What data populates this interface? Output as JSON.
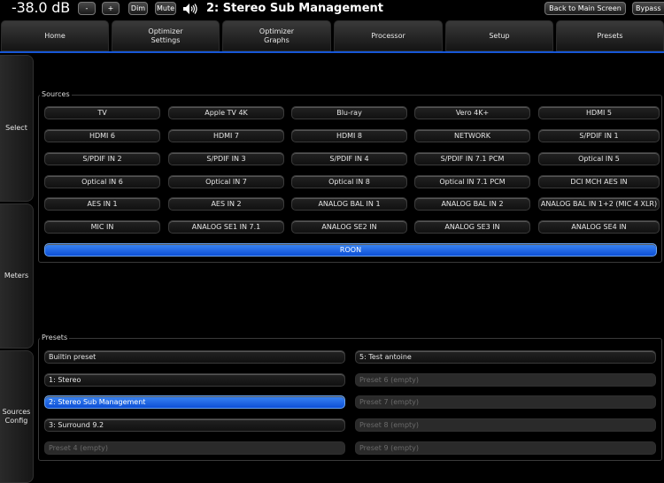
{
  "topbar": {
    "volume": "-38.0 dB",
    "minus_label": "-",
    "plus_label": "+",
    "dim_label": "Dim",
    "mute_label": "Mute",
    "speaker_icon": "speaker-icon",
    "current_preset": "2: Stereo Sub Management",
    "back_label": "Back to Main Screen",
    "bypass_label": "Bypass"
  },
  "tabs": [
    {
      "label": "Home",
      "active": true
    },
    {
      "label": "Optimizer\nSettings",
      "active": false
    },
    {
      "label": "Optimizer\nGraphs",
      "active": false
    },
    {
      "label": "Processor",
      "active": false
    },
    {
      "label": "Setup",
      "active": false
    },
    {
      "label": "Presets",
      "active": false
    }
  ],
  "side": [
    {
      "label": "Select",
      "active": true
    },
    {
      "label": "Meters",
      "active": false
    },
    {
      "label": "Sources\nConfig",
      "active": false
    }
  ],
  "sources": {
    "title": "Sources",
    "buttons": [
      "TV",
      "Apple TV 4K",
      "Blu-ray",
      "Vero 4K+",
      "HDMI 5",
      "HDMI 6",
      "HDMI 7",
      "HDMI 8",
      "NETWORK",
      "S/PDIF IN 1",
      "S/PDIF IN 2",
      "S/PDIF IN 3",
      "S/PDIF IN 4",
      "S/PDIF IN 7.1 PCM",
      "Optical IN 5",
      "Optical IN 6",
      "Optical IN 7",
      "Optical IN 8",
      "Optical IN 7.1 PCM",
      "DCI MCH AES IN",
      "AES IN 1",
      "AES IN 2",
      "ANALOG BAL IN 1",
      "ANALOG BAL IN 2",
      "ANALOG BAL IN 1+2 (MIC 4 XLR)",
      "MIC IN",
      "ANALOG SE1 IN 7.1",
      "ANALOG SE2 IN",
      "ANALOG SE3 IN",
      "ANALOG SE4 IN"
    ],
    "active_button": "ROON"
  },
  "presets": {
    "title": "Presets",
    "left": [
      {
        "label": "Builtin preset",
        "state": "normal"
      },
      {
        "label": "1: Stereo",
        "state": "normal"
      },
      {
        "label": "2: Stereo Sub Management",
        "state": "active"
      },
      {
        "label": "3: Surround 9.2",
        "state": "normal"
      },
      {
        "label": "Preset 4 (empty)",
        "state": "empty"
      }
    ],
    "right": [
      {
        "label": "5: Test antoine",
        "state": "normal"
      },
      {
        "label": "Preset 6 (empty)",
        "state": "empty"
      },
      {
        "label": "Preset 7 (empty)",
        "state": "empty"
      },
      {
        "label": "Preset 8 (empty)",
        "state": "empty"
      },
      {
        "label": "Preset 9 (empty)",
        "state": "empty"
      }
    ]
  },
  "colors": {
    "accent": "#1a5ee0",
    "background": "#000000"
  }
}
